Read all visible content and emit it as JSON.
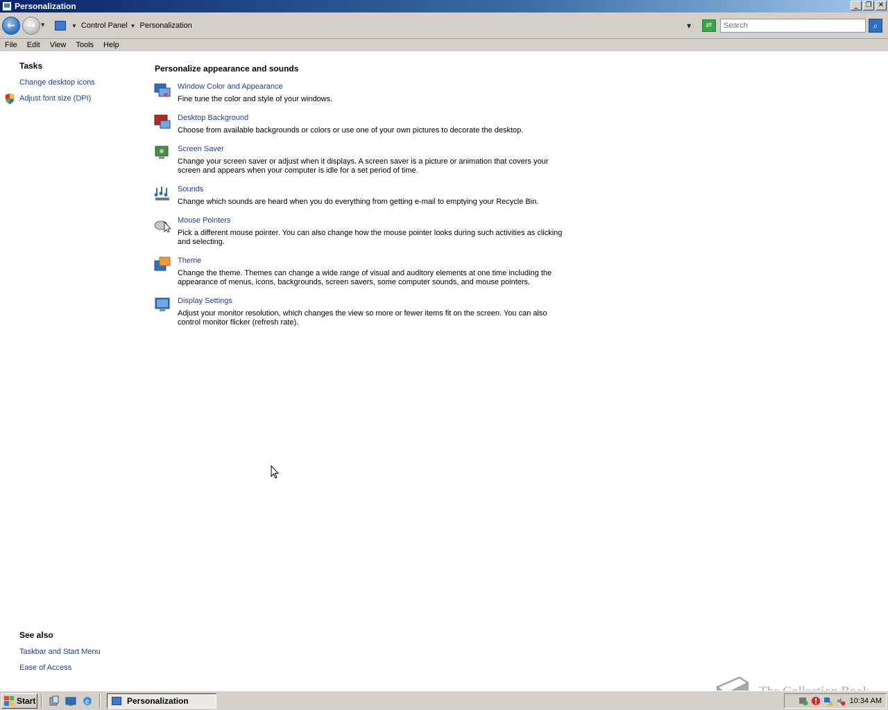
{
  "window": {
    "title": "Personalization"
  },
  "address": {
    "crumbs": [
      "Control Panel",
      "Personalization"
    ],
    "search_placeholder": "Search"
  },
  "menu": [
    "File",
    "Edit",
    "View",
    "Tools",
    "Help"
  ],
  "tasks": {
    "heading": "Tasks",
    "links": [
      "Change desktop icons",
      "Adjust font size (DPI)"
    ]
  },
  "main": {
    "heading": "Personalize appearance and sounds",
    "items": [
      {
        "title": "Window Color and Appearance",
        "desc": "Fine tune the color and style of your windows.",
        "icon": "window-color-icon"
      },
      {
        "title": "Desktop Background",
        "desc": "Choose from available backgrounds or colors or use one of your own pictures to decorate the desktop.",
        "icon": "desktop-background-icon"
      },
      {
        "title": "Screen Saver",
        "desc": "Change your screen saver or adjust when it displays. A screen saver is a picture or animation that covers your screen and appears when your computer is idle for a set period of time.",
        "icon": "screen-saver-icon"
      },
      {
        "title": "Sounds",
        "desc": "Change which sounds are heard when you do everything from getting e-mail to emptying your Recycle Bin.",
        "icon": "sounds-icon"
      },
      {
        "title": "Mouse Pointers",
        "desc": "Pick a different mouse pointer. You can also change how the mouse pointer looks during such activities as clicking and selecting.",
        "icon": "mouse-pointers-icon"
      },
      {
        "title": "Theme",
        "desc": "Change the theme. Themes can change a wide range of visual and auditory elements at one time including the appearance of menus, icons, backgrounds, screen savers, some computer sounds, and mouse pointers.",
        "icon": "theme-icon"
      },
      {
        "title": "Display Settings",
        "desc": "Adjust your monitor resolution, which changes the view so more or fewer items fit on the screen. You can also control monitor flicker (refresh rate).",
        "icon": "display-settings-icon"
      }
    ]
  },
  "see_also": {
    "heading": "See also",
    "links": [
      "Taskbar and Start Menu",
      "Ease of Access"
    ]
  },
  "taskbar": {
    "start_label": "Start",
    "task_button": "Personalization",
    "clock": "10:34 AM"
  },
  "watermark": "The Collection Book",
  "colors": {
    "link": "#1e3d9e",
    "title_bar_start": "#0a246a",
    "title_bar_end": "#a6caf0",
    "chrome": "#d4d0c8"
  }
}
